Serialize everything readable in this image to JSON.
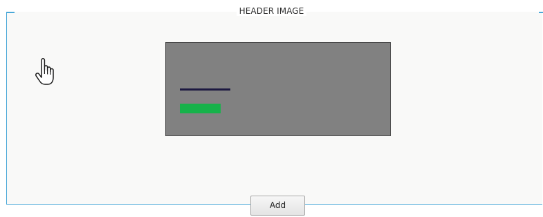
{
  "section": {
    "title": "HEADER IMAGE"
  },
  "preview": {
    "background_color": "#818181",
    "line_color": "#1c1840",
    "bar_color": "#16b24a"
  },
  "actions": {
    "add_label": "Add"
  },
  "cursor": {
    "icon": "hand-pointer-icon"
  },
  "colors": {
    "frame_border": "#4aa8d8",
    "panel_background": "#f9f9f8"
  }
}
